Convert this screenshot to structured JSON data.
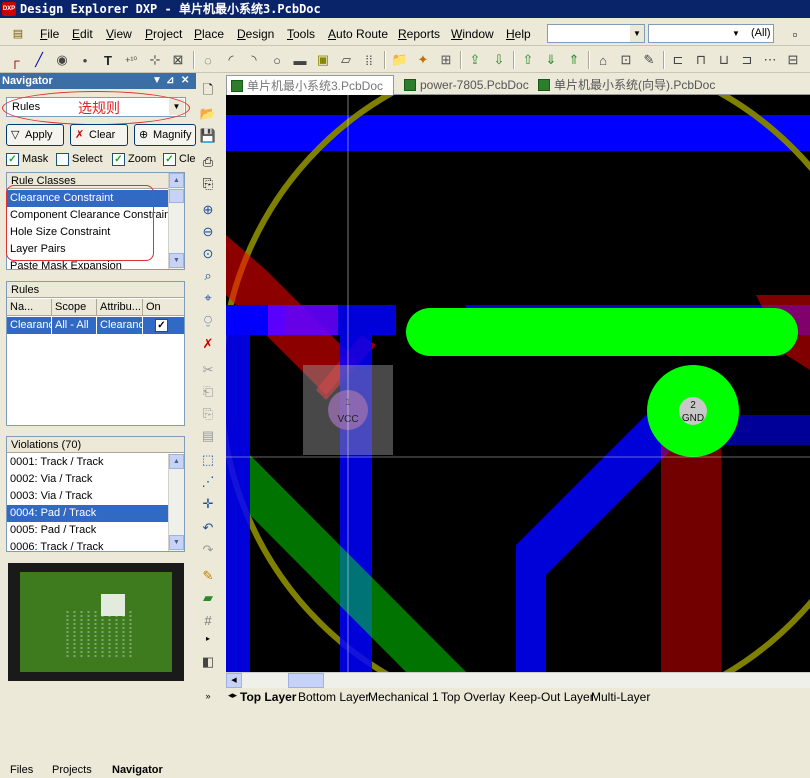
{
  "title": "Design Explorer DXP - 单片机最小系统3.PcbDoc",
  "app_icon": "DXP",
  "menu": [
    "File",
    "Edit",
    "View",
    "Project",
    "Place",
    "Design",
    "Tools",
    "Auto Route",
    "Reports",
    "Window",
    "Help"
  ],
  "toolbar_combo_right": "(All)",
  "navigator": {
    "header": "Navigator",
    "dropdown_value": "Rules",
    "annotation_select_rules": "选规则",
    "buttons": {
      "apply": "Apply",
      "clear": "Clear",
      "magnify": "Magnify"
    },
    "checks": [
      {
        "label": "Mask",
        "checked": true
      },
      {
        "label": "Select",
        "checked": false
      },
      {
        "label": "Zoom",
        "checked": true
      },
      {
        "label": "Cle",
        "checked": true
      }
    ],
    "rule_classes": {
      "header": "Rule Classes",
      "items": [
        "Clearance Constraint",
        "Component Clearance Constraint",
        "Hole Size Constraint",
        "Layer Pairs",
        "Paste Mask Expansion"
      ]
    },
    "rules": {
      "header": "Rules",
      "columns": [
        "Na...",
        "Scope",
        "Attribu...",
        "On"
      ],
      "row": {
        "name": "Clearanc",
        "scope": "All - All",
        "attributes": "Clearanc",
        "on": true
      }
    },
    "violations": {
      "header": "Violations (70)",
      "items": [
        "0001: Track / Track",
        "0002: Via / Track",
        "0003: Via / Track",
        "0004: Pad / Track",
        "0005: Pad / Track",
        "0006: Track / Track"
      ],
      "selected_index": 3
    },
    "bottom_tabs": [
      "Files",
      "Projects",
      "Navigator"
    ]
  },
  "document_tabs": [
    "单片机最小系统3.PcbDoc",
    "power-7805.PcbDoc",
    "单片机最小系统(向导).PcbDoc"
  ],
  "pcb": {
    "pad_vcc": {
      "number": "1",
      "net": "VCC"
    },
    "pad_gnd": {
      "number": "2",
      "net": "GND"
    },
    "colors": {
      "top_layer": "#ff0000",
      "bottom_layer": "#0000ff",
      "highlight": "#00ff00",
      "keepout": "#808000"
    }
  },
  "layer_tabs": [
    "Top Layer",
    "Bottom Layer",
    "Mechanical 1",
    "Top Overlay",
    "Keep-Out Layer",
    "Multi-Layer"
  ]
}
